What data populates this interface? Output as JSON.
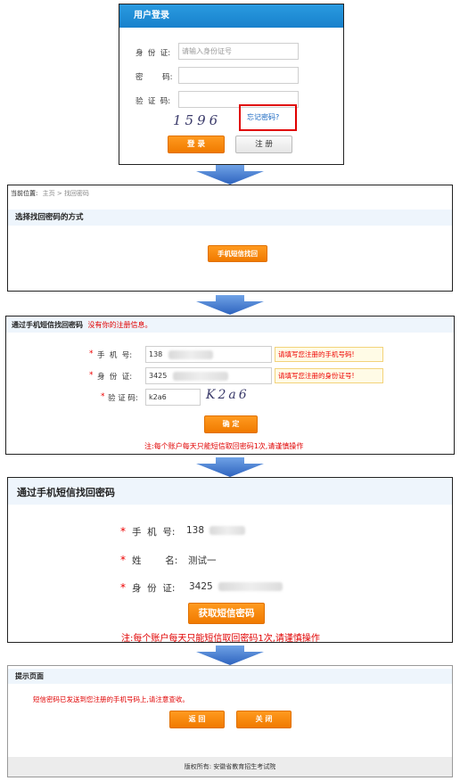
{
  "login": {
    "title": "用户登录",
    "id_label": "身  份  证:",
    "id_placeholder": "请输入身份证号",
    "password_label": "密        码:",
    "captcha_label": "验  证  码:",
    "captcha_text": "1596",
    "forgot_link": "忘记密码?",
    "login_button": "登 录",
    "register_button": "注 册"
  },
  "recover_method": {
    "breadcrumb_label": "当前位置:",
    "breadcrumb_home": "主页",
    "breadcrumb_sep": ">",
    "breadcrumb_current": "找回密码",
    "section_title": "选择找回密码的方式",
    "sms_button": "手机短信找回"
  },
  "sms_form": {
    "title": "通过手机短信找回密码",
    "error": "没有你的注册信息。",
    "phone_label": "手  机  号:",
    "phone_value": "138",
    "phone_hint": "请填写您注册的手机号码!",
    "id_label": "身  份  证:",
    "id_value": "3425",
    "id_hint": "请填写您注册的身份证号!",
    "captcha_label": "验 证 码:",
    "captcha_value": "k2a6",
    "captcha_image": "K2a6",
    "confirm_button": "确 定",
    "note": "注:每个账户每天只能短信取回密码1次,请谨慎操作"
  },
  "sms_confirm": {
    "title": "通过手机短信找回密码",
    "phone_label": "手  机  号:",
    "phone_value": "138",
    "name_label": "姓        名:",
    "name_value": "测试一",
    "id_label": "身  份  证:",
    "id_value": "3425",
    "get_code_button": "获取短信密码",
    "note": "注:每个账户每天只能短信取回密码1次,请谨慎操作"
  },
  "notice": {
    "title": "提示页面",
    "message": "短信密码已发送到您注册的手机号码上,请注意查收。",
    "back_button": "返 回",
    "close_button": "关 闭",
    "footer": "版权所有: 安徽省教育招生考试院"
  },
  "colors": {
    "header_blue": "#1f8fd8",
    "button_orange": "#f5850a",
    "arrow_blue": "#3a73c8",
    "error_red": "#e00000",
    "highlight_red": "#e00000"
  },
  "icons": [
    "flow-arrow-icon",
    "required-asterisk-icon"
  ]
}
